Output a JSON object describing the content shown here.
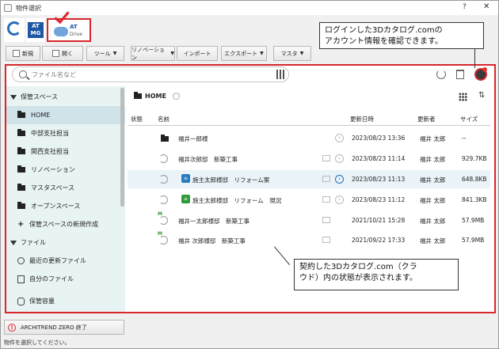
{
  "window": {
    "title": "物件選択",
    "help": "?",
    "close": "✕"
  },
  "app_tabs": {
    "atmg_label": "AT MG",
    "atdrive_label": "AT",
    "atdrive_sub": "Drive"
  },
  "toolbar": {
    "buttons": [
      "新規",
      "開く",
      "ツール",
      "リノベーション",
      "インポート",
      "エクスポート",
      "マスタ"
    ]
  },
  "search": {
    "placeholder": "ファイル名など"
  },
  "sidebar": {
    "storage_header": "保管スペース",
    "items": [
      "HOME",
      "中部支社担当",
      "関西支社担当",
      "リノベーション",
      "マスタスペース",
      "オープンスペース"
    ],
    "new_space": "保管スペースの新規作成",
    "file_header": "ファイル",
    "recent": "最近の更新ファイル",
    "mine": "自分のファイル",
    "capacity": "保管容量"
  },
  "main": {
    "path": "HOME",
    "columns": {
      "status": "状態",
      "name": "名前",
      "updated": "更新日時",
      "updater": "更新者",
      "size": "サイズ"
    },
    "rows": [
      {
        "name": "福井一郎様",
        "updated": "2023/08/23 13:36",
        "updater": "福井 太郎",
        "size": "--"
      },
      {
        "name": "福井次郎邸　新築工事",
        "updated": "2023/08/23 11:14",
        "updater": "福井 太郎",
        "size": "929.7KB"
      },
      {
        "name": "施主太郎様邸　リフォーム案",
        "updated": "2023/08/23 11:13",
        "updater": "福井 太郎",
        "size": "648.8KB"
      },
      {
        "name": "施主太郎様邸　リフォーム　現況",
        "updated": "2023/08/23 11:12",
        "updater": "福井 太郎",
        "size": "841.3KB"
      },
      {
        "name": "福井一太郎様邸　新築工事",
        "updated": "2021/10/21 15:28",
        "updater": "福井 太郎",
        "size": "57.9MB"
      },
      {
        "name": "福井 次郎様邸　新築工事",
        "updated": "2021/09/22 17:33",
        "updater": "福井 太郎",
        "size": "57.9MB"
      }
    ]
  },
  "callouts": {
    "top_line1": "ログインした3Dカタログ.comの",
    "top_line2": "アカウント情報を確認できます。",
    "mid_line1": "契約した3Dカタログ.com（クラ",
    "mid_line2": "ウド）内の状態が表示されます。"
  },
  "bottom": {
    "exit_button": "ARCHITREND ZERO 終了",
    "status": "物件を選択してください。"
  }
}
